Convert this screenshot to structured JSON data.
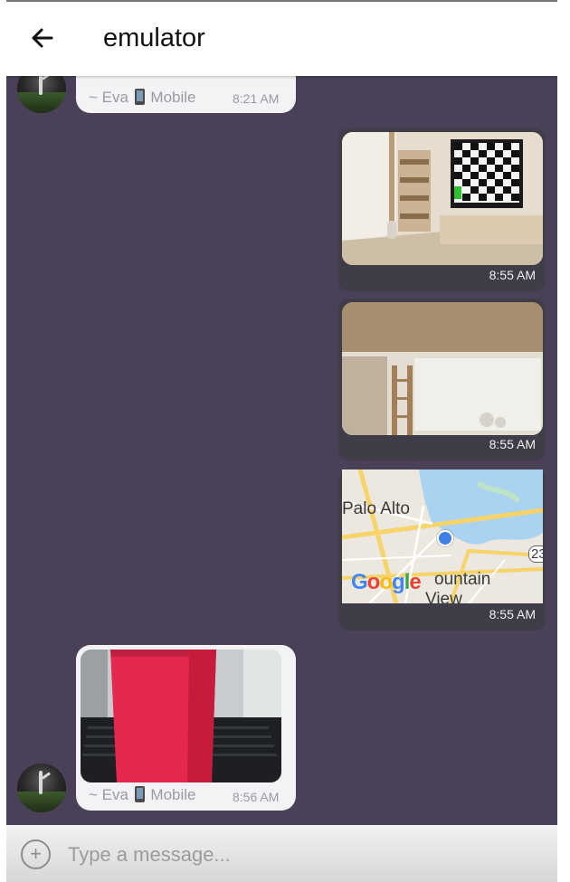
{
  "app_bar": {
    "title": "emulator"
  },
  "messages": [
    {
      "direction": "incoming",
      "sender": "~ Eva",
      "device": "Mobile",
      "time": "8:21 AM"
    },
    {
      "direction": "outgoing",
      "type": "image",
      "time": "8:55 AM"
    },
    {
      "direction": "outgoing",
      "type": "image",
      "time": "8:55 AM"
    },
    {
      "direction": "outgoing",
      "type": "location",
      "map": {
        "labels": [
          "Palo Alto",
          "ountain",
          "View",
          "23"
        ],
        "logo": "Google"
      },
      "time": "8:55 AM"
    },
    {
      "direction": "incoming",
      "type": "image",
      "sender": "~ Eva",
      "device": "Mobile",
      "time": "8:56 AM"
    }
  ],
  "composer": {
    "placeholder": "Type a message..."
  },
  "colors": {
    "chat_background": "#4a4159",
    "outgoing_bubble": "#3f3d48",
    "incoming_bubble": "#f3f3f5"
  },
  "icons": {
    "back": "arrow-left-icon",
    "add": "plus-circle-icon",
    "device": "phone-icon"
  }
}
